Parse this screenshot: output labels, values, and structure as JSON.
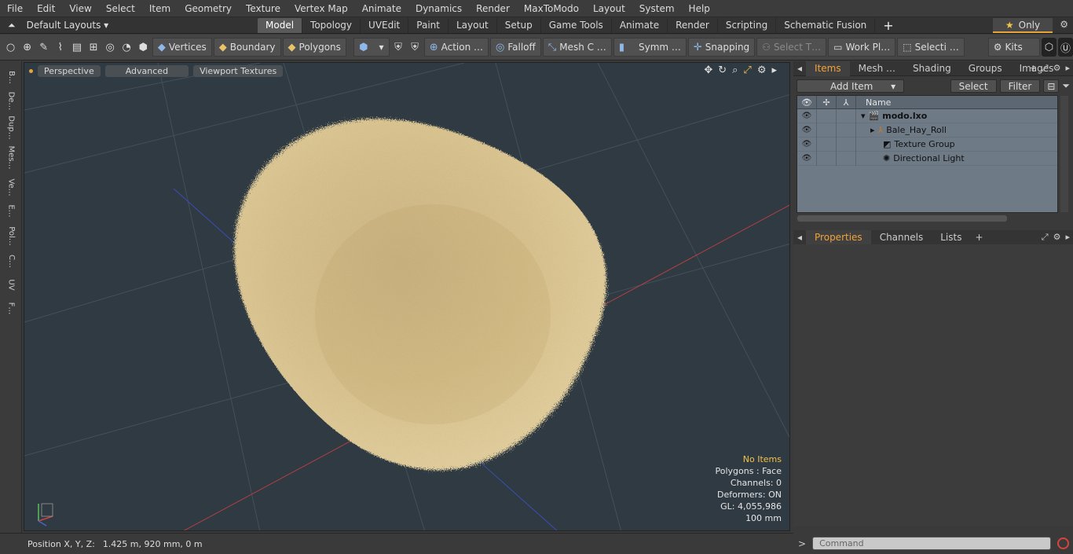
{
  "menu": [
    "File",
    "Edit",
    "View",
    "Select",
    "Item",
    "Geometry",
    "Texture",
    "Vertex Map",
    "Animate",
    "Dynamics",
    "Render",
    "MaxToModo",
    "Layout",
    "System",
    "Help"
  ],
  "layout_selector": "Default Layouts",
  "tabs": [
    "Model",
    "Topology",
    "UVEdit",
    "Paint",
    "Layout",
    "Setup",
    "Game Tools",
    "Animate",
    "Render",
    "Scripting",
    "Schematic Fusion"
  ],
  "only_label": "Only",
  "toolbar": {
    "vertices": "Vertices",
    "boundary": "Boundary",
    "polygons": "Polygons",
    "action": "Action …",
    "falloff": "Falloff",
    "mesh_c": "Mesh C …",
    "symm": "Symm …",
    "snapping": "Snapping",
    "select_t": "Select T…",
    "work_pl": "Work Pl…",
    "selecti": "Selecti …",
    "kits": "Kits"
  },
  "left_tabs": [
    "B…",
    "De…",
    "Dup…",
    "Mes…",
    "Ve…",
    "E…",
    "Pol…",
    "C…",
    "UV",
    "F…"
  ],
  "viewport": {
    "perspective": "Perspective",
    "advanced": "Advanced",
    "viewport_textures": "Viewport Textures",
    "info": {
      "no_items": "No Items",
      "polygons": "Polygons : Face",
      "channels": "Channels: 0",
      "deformers": "Deformers: ON",
      "gl": "GL: 4,055,986",
      "scale": "100 mm"
    }
  },
  "status": {
    "position_label": "Position X, Y, Z:",
    "position_value": "1.425 m, 920 mm, 0 m"
  },
  "items_panel": {
    "tabs": [
      "Items",
      "Mesh …",
      "Shading",
      "Groups",
      "Images"
    ],
    "add_item": "Add Item",
    "select": "Select",
    "filter": "Filter",
    "name_header": "Name",
    "rows": [
      "modo.lxo",
      "Bale_Hay_Roll",
      "Texture Group",
      "Directional Light"
    ]
  },
  "properties_panel": {
    "tabs": [
      "Properties",
      "Channels",
      "Lists"
    ]
  },
  "command": {
    "placeholder": "Command"
  },
  "colors": {
    "accent": "#e8a33a",
    "viewport_bg": "#2f3a43",
    "hay": "#d9bf7f"
  }
}
